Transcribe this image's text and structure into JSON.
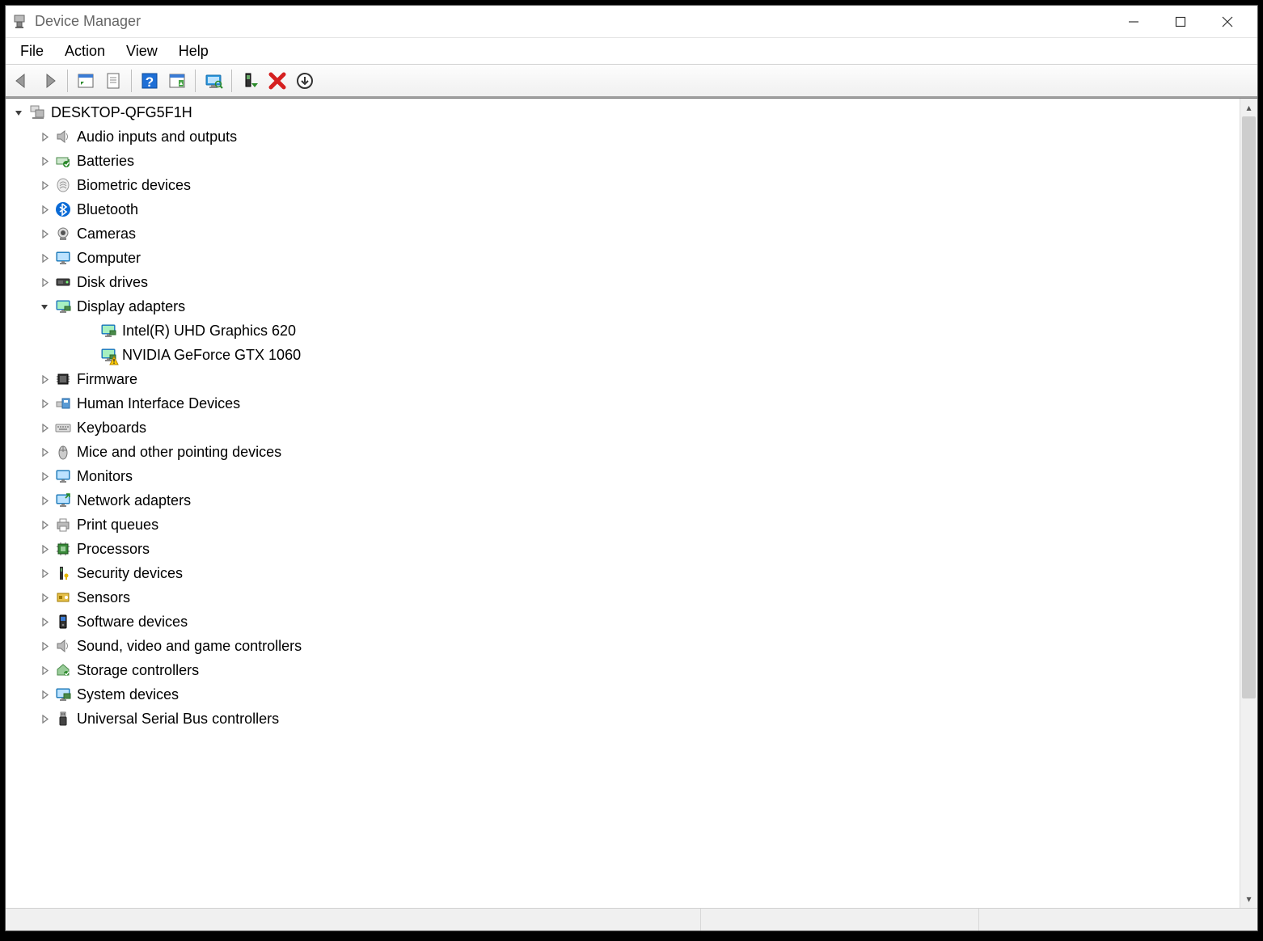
{
  "window": {
    "title": "Device Manager"
  },
  "menubar": {
    "items": [
      "File",
      "Action",
      "View",
      "Help"
    ]
  },
  "toolbar": {
    "buttons": [
      {
        "name": "back-button",
        "icon": "arrow-left",
        "sep": false
      },
      {
        "name": "forward-button",
        "icon": "arrow-right",
        "sep": true
      },
      {
        "name": "show-hidden-button",
        "icon": "panel",
        "sep": false
      },
      {
        "name": "properties-button",
        "icon": "sheet",
        "sep": true
      },
      {
        "name": "help-button",
        "icon": "help",
        "sep": false
      },
      {
        "name": "action-pane-button",
        "icon": "panel-green",
        "sep": true
      },
      {
        "name": "scan-hardware-button",
        "icon": "monitor-scan",
        "sep": true
      },
      {
        "name": "enable-device-button",
        "icon": "device-up",
        "sep": false
      },
      {
        "name": "disable-device-button",
        "icon": "red-x",
        "sep": false
      },
      {
        "name": "uninstall-device-button",
        "icon": "circle-down",
        "sep": false
      }
    ]
  },
  "tree": {
    "root": {
      "label": "DESKTOP-QFG5F1H",
      "icon": "computer-icon",
      "expanded": true
    },
    "categories": [
      {
        "label": "Audio inputs and outputs",
        "icon": "speaker-icon",
        "expanded": false,
        "children": []
      },
      {
        "label": "Batteries",
        "icon": "battery-icon",
        "expanded": false,
        "children": []
      },
      {
        "label": "Biometric devices",
        "icon": "fingerprint-icon",
        "expanded": false,
        "children": []
      },
      {
        "label": "Bluetooth",
        "icon": "bluetooth-icon",
        "expanded": false,
        "children": []
      },
      {
        "label": "Cameras",
        "icon": "camera-icon",
        "expanded": false,
        "children": []
      },
      {
        "label": "Computer",
        "icon": "monitor-icon",
        "expanded": false,
        "children": []
      },
      {
        "label": "Disk drives",
        "icon": "disk-icon",
        "expanded": false,
        "children": []
      },
      {
        "label": "Display adapters",
        "icon": "display-adapter-icon",
        "expanded": true,
        "children": [
          {
            "label": "Intel(R) UHD Graphics 620",
            "icon": "display-adapter-icon",
            "warning": false
          },
          {
            "label": "NVIDIA GeForce GTX 1060",
            "icon": "display-adapter-icon",
            "warning": true
          }
        ]
      },
      {
        "label": "Firmware",
        "icon": "chip-icon",
        "expanded": false,
        "children": []
      },
      {
        "label": "Human Interface Devices",
        "icon": "hid-icon",
        "expanded": false,
        "children": []
      },
      {
        "label": "Keyboards",
        "icon": "keyboard-icon",
        "expanded": false,
        "children": []
      },
      {
        "label": "Mice and other pointing devices",
        "icon": "mouse-icon",
        "expanded": false,
        "children": []
      },
      {
        "label": "Monitors",
        "icon": "monitor-icon",
        "expanded": false,
        "children": []
      },
      {
        "label": "Network adapters",
        "icon": "network-icon",
        "expanded": false,
        "children": []
      },
      {
        "label": "Print queues",
        "icon": "printer-icon",
        "expanded": false,
        "children": []
      },
      {
        "label": "Processors",
        "icon": "cpu-icon",
        "expanded": false,
        "children": []
      },
      {
        "label": "Security devices",
        "icon": "security-icon",
        "expanded": false,
        "children": []
      },
      {
        "label": "Sensors",
        "icon": "sensor-icon",
        "expanded": false,
        "children": []
      },
      {
        "label": "Software devices",
        "icon": "software-icon",
        "expanded": false,
        "children": []
      },
      {
        "label": "Sound, video and game controllers",
        "icon": "speaker-icon",
        "expanded": false,
        "children": []
      },
      {
        "label": "Storage controllers",
        "icon": "storage-icon",
        "expanded": false,
        "children": []
      },
      {
        "label": "System devices",
        "icon": "system-icon",
        "expanded": false,
        "children": []
      },
      {
        "label": "Universal Serial Bus controllers",
        "icon": "usb-icon",
        "expanded": false,
        "children": []
      }
    ]
  }
}
